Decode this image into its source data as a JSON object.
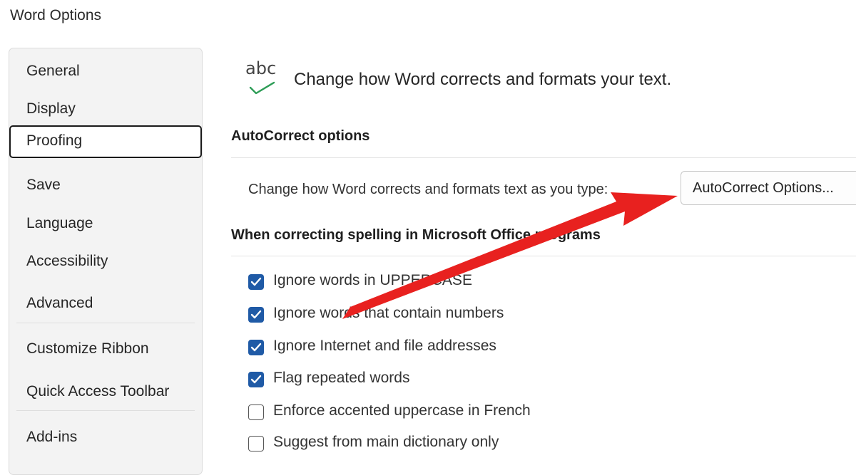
{
  "window": {
    "title": "Word Options"
  },
  "sidebar": {
    "items": [
      {
        "label": "General"
      },
      {
        "label": "Display"
      },
      {
        "label": "Proofing",
        "selected": true
      },
      {
        "label": "Save"
      },
      {
        "label": "Language"
      },
      {
        "label": "Accessibility"
      },
      {
        "label": "Advanced"
      },
      {
        "label": "Customize Ribbon"
      },
      {
        "label": "Quick Access Toolbar"
      },
      {
        "label": "Add-ins"
      }
    ]
  },
  "main": {
    "header_icon_text": "abc",
    "header_text": "Change how Word corrects and formats your text.",
    "autocorrect_section": {
      "title": "AutoCorrect options",
      "label": "Change how Word corrects and formats text as you type:",
      "button_label": "AutoCorrect Options..."
    },
    "spelling_section": {
      "title": "When correcting spelling in Microsoft Office programs",
      "options": [
        {
          "label": "Ignore words in UPPERCASE",
          "checked": true
        },
        {
          "label": "Ignore words that contain numbers",
          "checked": true
        },
        {
          "label": "Ignore Internet and file addresses",
          "checked": true
        },
        {
          "label": "Flag repeated words",
          "checked": true
        },
        {
          "label": "Enforce accented uppercase in French",
          "checked": false
        },
        {
          "label": "Suggest from main dictionary only",
          "checked": false
        }
      ]
    }
  },
  "colors": {
    "checkbox_checked": "#1f5aa6",
    "annotation_arrow": "#e8211f",
    "checkmark_icon": "#2e9d57"
  }
}
